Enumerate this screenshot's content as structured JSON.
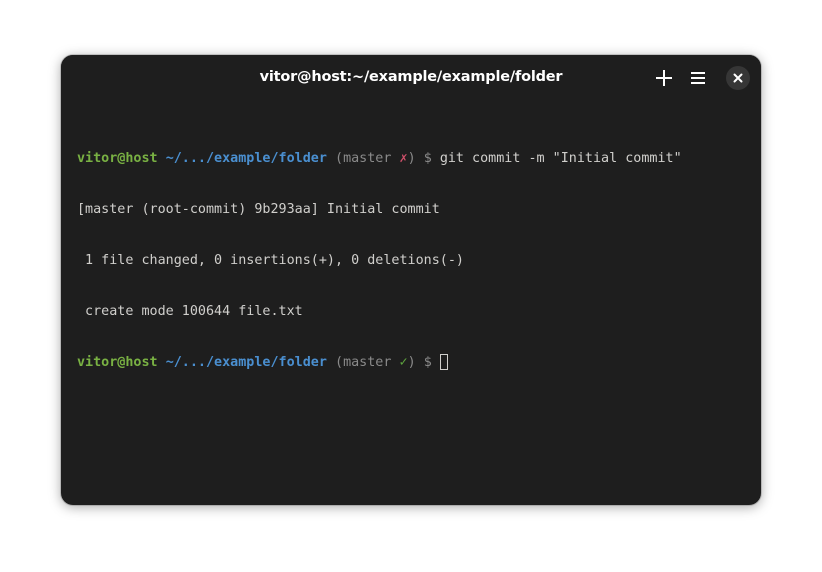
{
  "window": {
    "title": "vitor@host:~/example/example/folder",
    "buttons": {
      "new_tab": "plus-icon",
      "menu": "hamburger-menu-icon",
      "close": "close-icon"
    }
  },
  "terminal": {
    "prompt1": {
      "user_host": "vitor@host",
      "path": "~/.../example/folder",
      "open": " (",
      "branch": "master",
      "status": "✗",
      "close": ")",
      "dollar": "$",
      "command": "git commit -m \"Initial commit\""
    },
    "output": [
      "[master (root-commit) 9b293aa] Initial commit",
      " 1 file changed, 0 insertions(+), 0 deletions(-)",
      " create mode 100644 file.txt"
    ],
    "prompt2": {
      "user_host": "vitor@host",
      "path": "~/.../example/folder",
      "open": " (",
      "branch": "master",
      "status": "✓",
      "close": ")",
      "dollar": "$",
      "command": ""
    }
  },
  "colors": {
    "background": "#1e1e1e",
    "user_host": "#79b143",
    "path": "#4a8fd0",
    "dirty_status": "#d0506a",
    "clean_status": "#5ea53e",
    "text": "#d0cfcc"
  }
}
